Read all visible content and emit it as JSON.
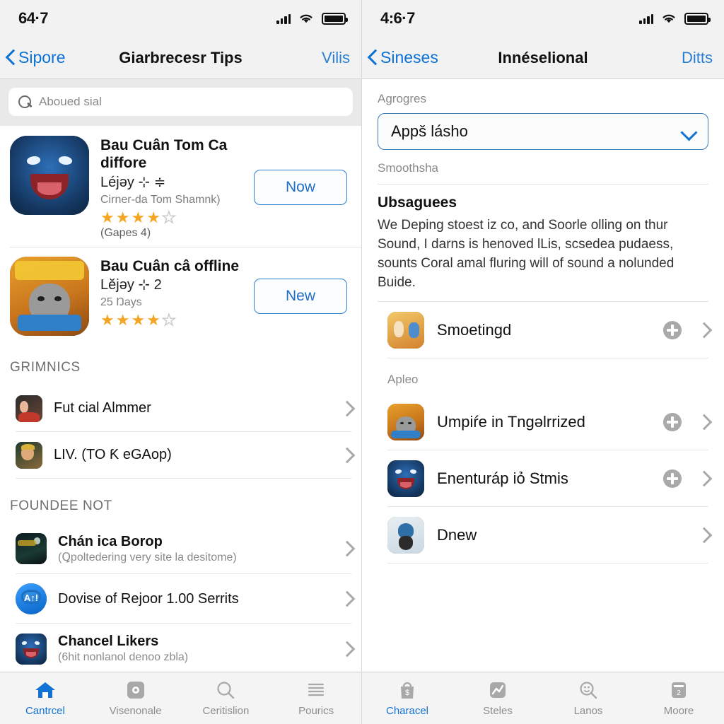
{
  "left": {
    "status": {
      "time": "64·7"
    },
    "nav": {
      "back_label": "Sipore",
      "title": "Giarbrecesr Tips",
      "action_label": "Vilis"
    },
    "search": {
      "placeholder": "Aboued sial",
      "value": ""
    },
    "apps": [
      {
        "title": "Bau Cuân Tom Ca diffore",
        "subtitle": "Léjəy ⊹ ≑",
        "note": "Cirner-da Tom Shamnk)",
        "stars_filled": 4,
        "stars_total": 5,
        "rating_count": "(Gapes 4)",
        "button": "Now",
        "icon": "blue-monster-app-icon"
      },
      {
        "title": "Bau Cuân câ offline",
        "subtitle": "Lĕjəy ⊹ 2",
        "note": "25 Ŋays",
        "stars_filled": 4,
        "stars_total": 5,
        "rating_count": "",
        "button": "New",
        "icon": "cat-game-app-icon"
      }
    ],
    "sections": [
      {
        "header": "GRIMNICS",
        "rows": [
          {
            "title": "Fut cial Almmer",
            "subtitle": "",
            "bold": false,
            "icon": "family-photo-icon"
          },
          {
            "title": "LIV. (TO Ƙ eGAop)",
            "subtitle": "",
            "bold": false,
            "icon": "portrait-icon"
          }
        ]
      },
      {
        "header": "FOUNDEE NOT",
        "rows": [
          {
            "title": "Chán ica Borop",
            "subtitle": "(Ꝗpoltedering very site la desitome)",
            "bold": true,
            "icon": "night-scene-icon"
          },
          {
            "title": "Dovise of Rejoor 1.00 Serrits",
            "subtitle": "",
            "bold": false,
            "icon": "chat-bubble-icon"
          },
          {
            "title": "Chancel Likers",
            "subtitle": "(6hit nonlanol denoo zbla)",
            "bold": true,
            "icon": "blue-monster-icon"
          }
        ]
      }
    ],
    "tabs": [
      {
        "label": "Cantrcel",
        "icon": "home-icon",
        "active": true
      },
      {
        "label": "Visenonale",
        "icon": "settings-icon",
        "active": false
      },
      {
        "label": "Ceritislion",
        "icon": "search-icon",
        "active": false
      },
      {
        "label": "Pourics",
        "icon": "list-icon",
        "active": false
      }
    ]
  },
  "right": {
    "status": {
      "time": "4:6·7"
    },
    "nav": {
      "back_label": "Sineses",
      "title": "Innéselional",
      "action_label": "Ditts"
    },
    "form": {
      "field_label": "Agrogres",
      "select_value": "Appš lásho",
      "hint": "Smoothsha"
    },
    "info": {
      "title": "Ubsaguees",
      "body": "We Deping stoest iz co, and Soorle olling on thur Sound, I darns is henoved lLis, scsedea pudaess, sounts Coral amal fluring will of sound a nolunded Buide."
    },
    "first_row": {
      "title": "Smoetingd",
      "icon": "kids-game-icon",
      "has_plus": true
    },
    "group_label": "Apleo",
    "rows": [
      {
        "title": "Umpiŕe in Tngəlrrized",
        "icon": "cat-game-icon",
        "has_plus": true
      },
      {
        "title": "Enenturáp iỏ Stmis",
        "icon": "blue-monster-icon",
        "has_plus": true
      },
      {
        "title": "Dnew",
        "icon": "penguin-icon",
        "has_plus": false
      }
    ],
    "tabs": [
      {
        "label": "Characel",
        "icon": "shop-bag-icon",
        "active": true
      },
      {
        "label": "Steles",
        "icon": "chart-icon",
        "active": false
      },
      {
        "label": "Lanos",
        "icon": "search-face-icon",
        "active": false
      },
      {
        "label": "Moore",
        "icon": "archive-icon",
        "active": false
      }
    ]
  },
  "colors": {
    "accent_blue": "#1273d4",
    "star_orange": "#f5a524",
    "muted_grey": "#8a8a8a"
  }
}
